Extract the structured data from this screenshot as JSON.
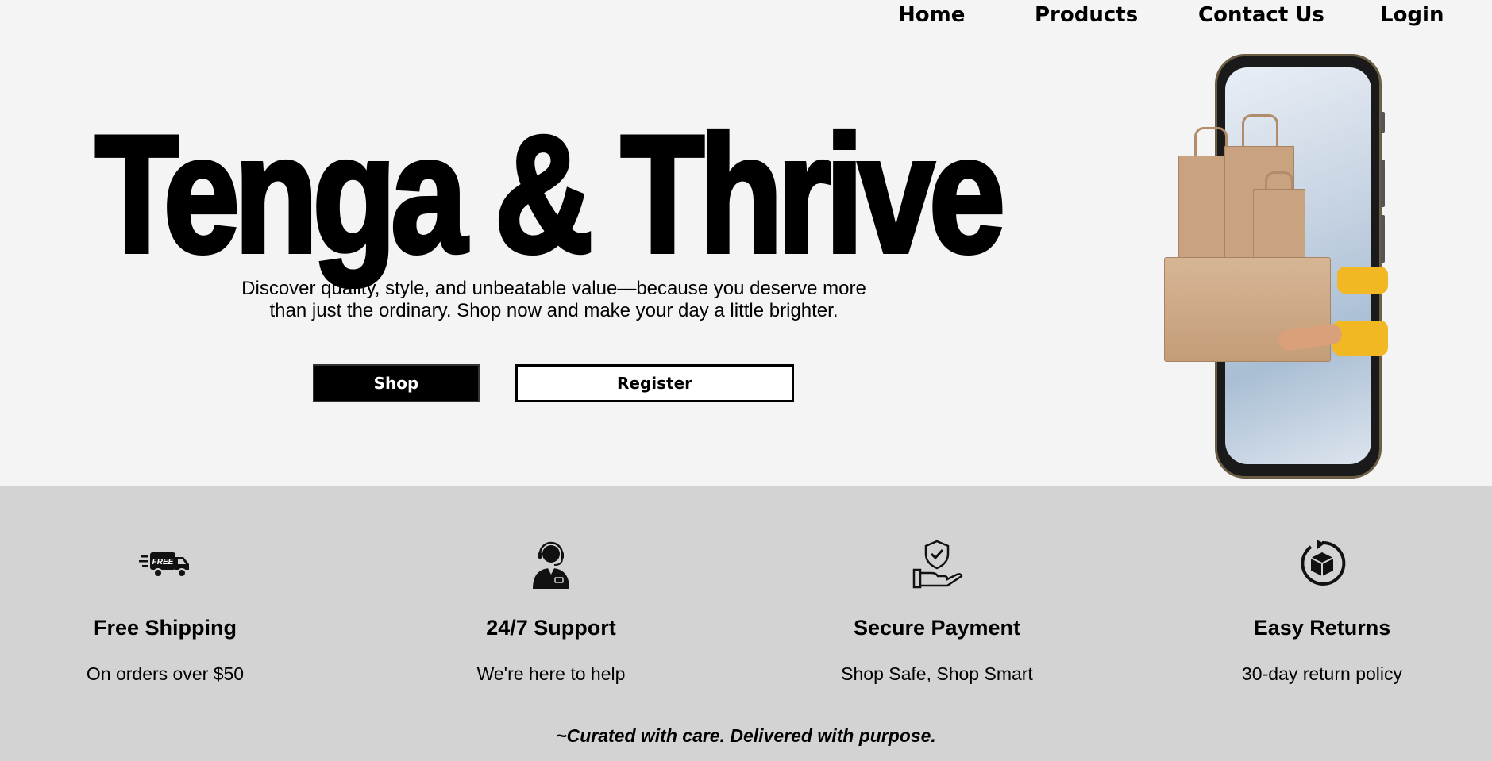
{
  "nav": {
    "items": [
      {
        "label": "Home"
      },
      {
        "label": "Products"
      },
      {
        "label": "Contact Us"
      },
      {
        "label": "Login"
      }
    ]
  },
  "hero": {
    "title": "Tenga & Thrive",
    "tagline": "Discover quality, style, and unbeatable value—because you deserve more than just the ordinary. Shop now and make your day a little brighter.",
    "shop_label": "Shop",
    "register_label": "Register",
    "illustration": "phone-with-shopping-bags-and-package-icon"
  },
  "features": [
    {
      "icon": "free-delivery-truck-icon",
      "icon_text": "FREE",
      "title": "Free Shipping",
      "desc": "On orders over $50"
    },
    {
      "icon": "support-agent-headset-icon",
      "title": "24/7 Support",
      "desc": "We're here to help"
    },
    {
      "icon": "secure-payment-shield-hand-icon",
      "title": "Secure Payment",
      "desc": "Shop Safe, Shop Smart"
    },
    {
      "icon": "return-box-icon",
      "title": "Easy Returns",
      "desc": "30-day return policy"
    }
  ],
  "motto": "~Curated with care. Delivered with purpose.",
  "colors": {
    "hero_bg": "#f4f4f4",
    "features_bg": "#d3d3d3",
    "primary": "#000000",
    "on_primary": "#ffffff"
  }
}
